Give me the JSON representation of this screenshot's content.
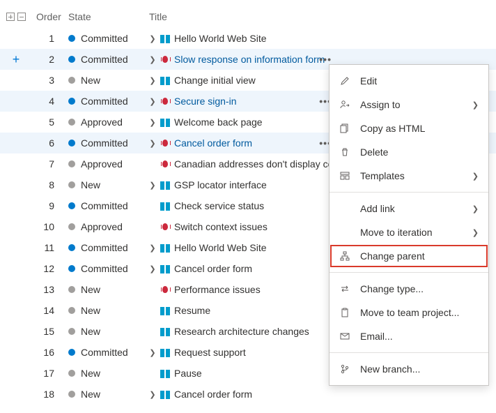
{
  "columns": {
    "order": "Order",
    "state": "State",
    "title": "Title"
  },
  "state_colors": {
    "Committed": "#007acc",
    "New": "#a19f9d",
    "Approved": "#a19f9d"
  },
  "rows": [
    {
      "order": "1",
      "state": "Committed",
      "type": "pbi",
      "title": "Hello World Web Site",
      "expandable": true,
      "selected": false,
      "link": false
    },
    {
      "order": "2",
      "state": "Committed",
      "type": "bug",
      "title": "Slow response on information form",
      "expandable": true,
      "selected": true,
      "link": true
    },
    {
      "order": "3",
      "state": "New",
      "type": "pbi",
      "title": "Change initial view",
      "expandable": true,
      "selected": false,
      "link": false
    },
    {
      "order": "4",
      "state": "Committed",
      "type": "bug",
      "title": "Secure sign-in",
      "expandable": true,
      "selected": true,
      "link": true
    },
    {
      "order": "5",
      "state": "Approved",
      "type": "pbi",
      "title": "Welcome back page",
      "expandable": true,
      "selected": false,
      "link": false
    },
    {
      "order": "6",
      "state": "Committed",
      "type": "bug",
      "title": "Cancel order form",
      "expandable": true,
      "selected": true,
      "link": true
    },
    {
      "order": "7",
      "state": "Approved",
      "type": "bug",
      "title": "Canadian addresses don't display correctly",
      "expandable": false,
      "selected": false,
      "link": false
    },
    {
      "order": "8",
      "state": "New",
      "type": "pbi",
      "title": "GSP locator interface",
      "expandable": true,
      "selected": false,
      "link": false
    },
    {
      "order": "9",
      "state": "Committed",
      "type": "pbi",
      "title": "Check service status",
      "expandable": false,
      "selected": false,
      "link": false
    },
    {
      "order": "10",
      "state": "Approved",
      "type": "bug",
      "title": "Switch context issues",
      "expandable": false,
      "selected": false,
      "link": false
    },
    {
      "order": "11",
      "state": "Committed",
      "type": "pbi",
      "title": "Hello World Web Site",
      "expandable": true,
      "selected": false,
      "link": false
    },
    {
      "order": "12",
      "state": "Committed",
      "type": "pbi",
      "title": "Cancel order form",
      "expandable": true,
      "selected": false,
      "link": false
    },
    {
      "order": "13",
      "state": "New",
      "type": "bug",
      "title": "Performance issues",
      "expandable": false,
      "selected": false,
      "link": false
    },
    {
      "order": "14",
      "state": "New",
      "type": "pbi",
      "title": "Resume",
      "expandable": false,
      "selected": false,
      "link": false
    },
    {
      "order": "15",
      "state": "New",
      "type": "pbi",
      "title": "Research architecture changes",
      "expandable": false,
      "selected": false,
      "link": false
    },
    {
      "order": "16",
      "state": "Committed",
      "type": "pbi",
      "title": "Request support",
      "expandable": true,
      "selected": false,
      "link": false
    },
    {
      "order": "17",
      "state": "New",
      "type": "pbi",
      "title": "Pause",
      "expandable": false,
      "selected": false,
      "link": false
    },
    {
      "order": "18",
      "state": "New",
      "type": "pbi",
      "title": "Cancel order form",
      "expandable": true,
      "selected": false,
      "link": false
    }
  ],
  "add_handle_row": 2,
  "menu": {
    "edit": "Edit",
    "assign_to": "Assign to",
    "copy_html": "Copy as HTML",
    "delete": "Delete",
    "templates": "Templates",
    "add_link": "Add link",
    "move_to_iteration": "Move to iteration",
    "change_parent": "Change parent",
    "change_type": "Change type...",
    "move_to_team_project": "Move to team project...",
    "email": "Email...",
    "new_branch": "New branch..."
  }
}
